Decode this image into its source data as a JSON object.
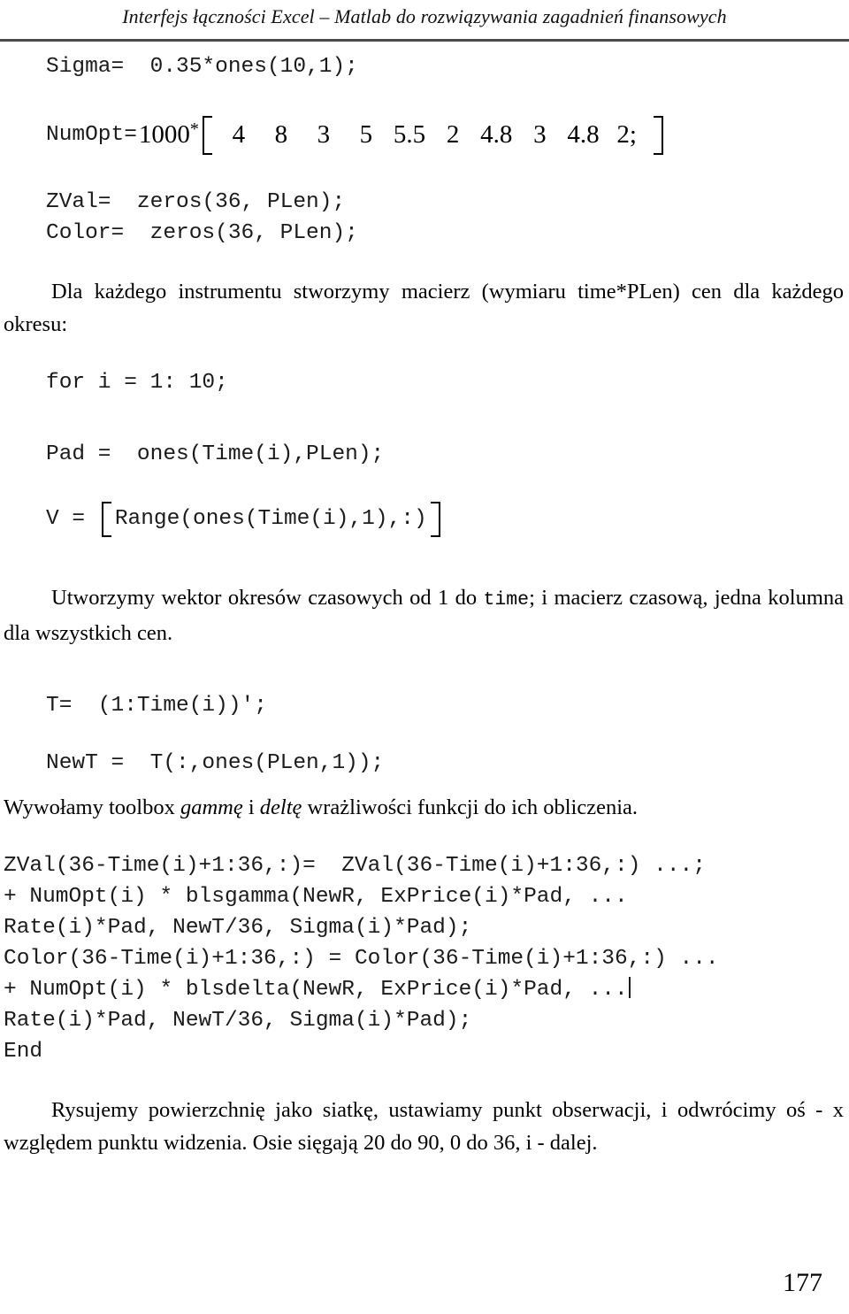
{
  "header": {
    "title": "Interfejs łączności Excel – Matlab do rozwiązywania zagadnień finansowych"
  },
  "code": {
    "sigma": "Sigma=  0.35*ones(10,1);",
    "zval": "ZVal=  zeros(36, PLen);",
    "color": "Color=  zeros(36, PLen);",
    "for_loop": "for i = 1: 10;",
    "pad": "Pad =  ones(Time(i),PLen);",
    "t_line": "T=  (1:Time(i))';",
    "newt": "NewT =  T(:,ones(PLen,1));",
    "block2_line1": "ZVal(36-Time(i)+1:36,:)=  ZVal(36-Time(i)+1:36,:) ...;",
    "block2_line2": "+ NumOpt(i) * blsgamma(NewR, ExPrice(i)*Pad, ...",
    "block2_line3": "Rate(i)*Pad, NewT/36, Sigma(i)*Pad);",
    "block2_line4": "Color(36-Time(i)+1:36,:) = Color(36-Time(i)+1:36,:) ...",
    "block2_line5": "+ NumOpt(i) * blsdelta(NewR, ExPrice(i)*Pad, ...",
    "block2_line6": "Rate(i)*Pad, NewT/36, Sigma(i)*Pad);",
    "block2_line7": "End"
  },
  "numopt": {
    "label": "NumOpt=",
    "scalar": "1000",
    "star": "*",
    "values": [
      "4",
      "8",
      "3",
      "5",
      "5.5",
      "2",
      "4.8",
      "3",
      "4.8",
      "2;"
    ]
  },
  "vrow": {
    "label": "V = ",
    "inner": "Range(ones(Time(i),1),:)"
  },
  "paragraphs": {
    "p1_text": "Dla każdego instrumentu stworzymy macierz (wymiaru time*PLen) cen dla każdego okresu:",
    "p2_a": "Utworzymy wektor okresów czasowych od 1 do ",
    "p2_mono": "time",
    "p2_b": "; i macierz czasową, jedna kolumna dla wszystkich cen.",
    "p3_a": "Wywołamy toolbox ",
    "p3_it1": "gammę",
    "p3_b": " i ",
    "p3_it2": "deltę",
    "p3_c": "  wrażliwości funkcji do ich obliczenia.",
    "p4_text": "Rysujemy powierzchnię jako siatkę, ustawiamy punkt obserwacji, i odwrócimy oś - x względem punktu widzenia. Osie sięgają 20 do 90, 0 do 36, i - dalej."
  },
  "footer": {
    "page_number": "177"
  }
}
